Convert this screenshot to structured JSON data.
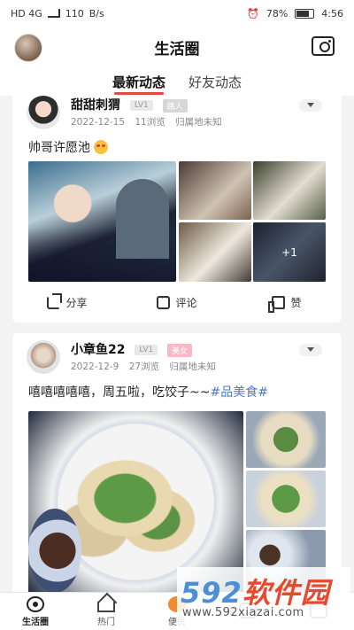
{
  "status_bar": {
    "network": "HD 4G",
    "speed": "110",
    "speed_unit": "B/s",
    "battery": "78%",
    "time": "4:56"
  },
  "header": {
    "title": "生活圈"
  },
  "tabs": [
    {
      "label": "最新动态",
      "active": true
    },
    {
      "label": "好友动态",
      "active": false
    }
  ],
  "posts": [
    {
      "user": "甜甜刺猬",
      "level": "LV1",
      "role": "路人",
      "date": "2022-12-15",
      "views": "11浏览",
      "location": "归属地未知",
      "text": "帅哥许愿池",
      "more_photos": "+1",
      "actions": {
        "share": "分享",
        "comment": "评论",
        "like": "赞"
      }
    },
    {
      "user": "小章鱼22",
      "level": "LV1",
      "role": "美女",
      "date": "2022-12-9",
      "views": "27浏览",
      "location": "归属地未知",
      "text": "嘻嘻嘻嘻嘻，周五啦，吃饺子~~",
      "hashtag": "#品美食#"
    }
  ],
  "watermark": {
    "brand_num": "592",
    "brand_text": "软件园",
    "url": "www.592xiazai.com"
  },
  "bottom_nav": [
    {
      "label": "生活圈",
      "active": true
    },
    {
      "label": "热门",
      "active": false
    },
    {
      "label": "便民",
      "active": false
    },
    {
      "label": "",
      "active": false
    },
    {
      "label": "",
      "active": false
    }
  ],
  "colors": {
    "accent": "#e04a3f",
    "hashtag": "#4b78c9",
    "watermark_blue": "#4a8fd8",
    "watermark_red": "#e8492c"
  }
}
